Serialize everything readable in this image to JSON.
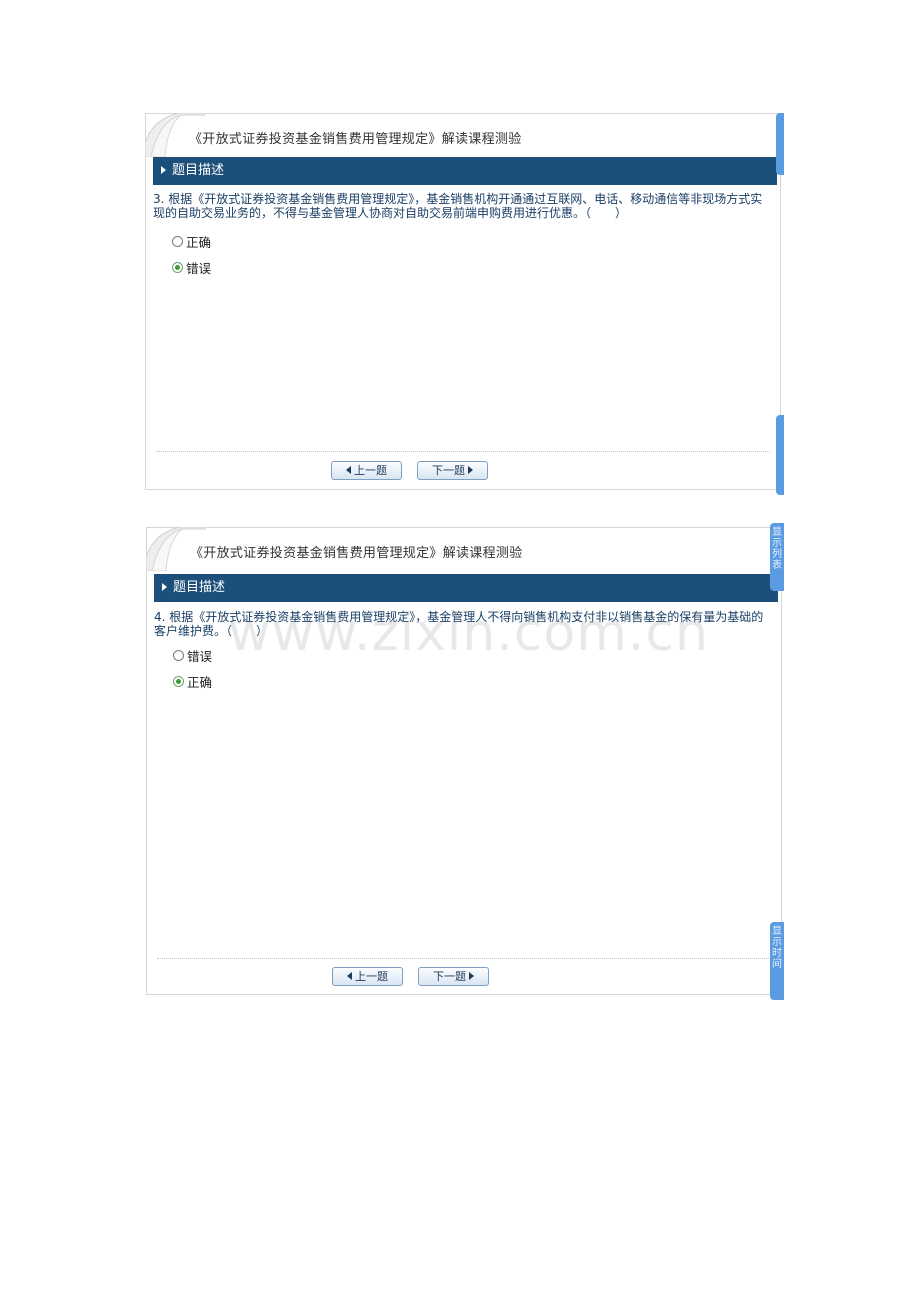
{
  "colors": {
    "section_bar": "#1c4f7a",
    "question_text": "#1a3f66",
    "side_tab": "#5b9be2",
    "radio_checked": "#3d9b3d"
  },
  "panels": [
    {
      "title": "《开放式证券投资基金销售费用管理规定》解读课程测验",
      "section_label": "题目描述",
      "question": "3. 根据《开放式证券投资基金销售费用管理规定》，基金销售机构开通通过互联网、电话、移动通信等非现场方式实现的自助交易业务的，不得与基金管理人协商对自助交易前端申购费用进行优惠。（　　）",
      "options": [
        {
          "label": "正确",
          "selected": false
        },
        {
          "label": "错误",
          "selected": true
        }
      ],
      "prev_label": "上一题",
      "next_label": "下一题"
    },
    {
      "title": "《开放式证券投资基金销售费用管理规定》解读课程测验",
      "section_label": "题目描述",
      "question": "4. 根据《开放式证券投资基金销售费用管理规定》，基金管理人不得向销售机构支付非以销售基金的保有量为基础的客户维护费。（　　）",
      "options": [
        {
          "label": "错误",
          "selected": false
        },
        {
          "label": "正确",
          "selected": true
        }
      ],
      "prev_label": "上一题",
      "next_label": "下一题",
      "side_tab_list": "显示列表",
      "side_tab_time": "显示时间"
    }
  ],
  "watermark": "www.zixin.com.cn"
}
